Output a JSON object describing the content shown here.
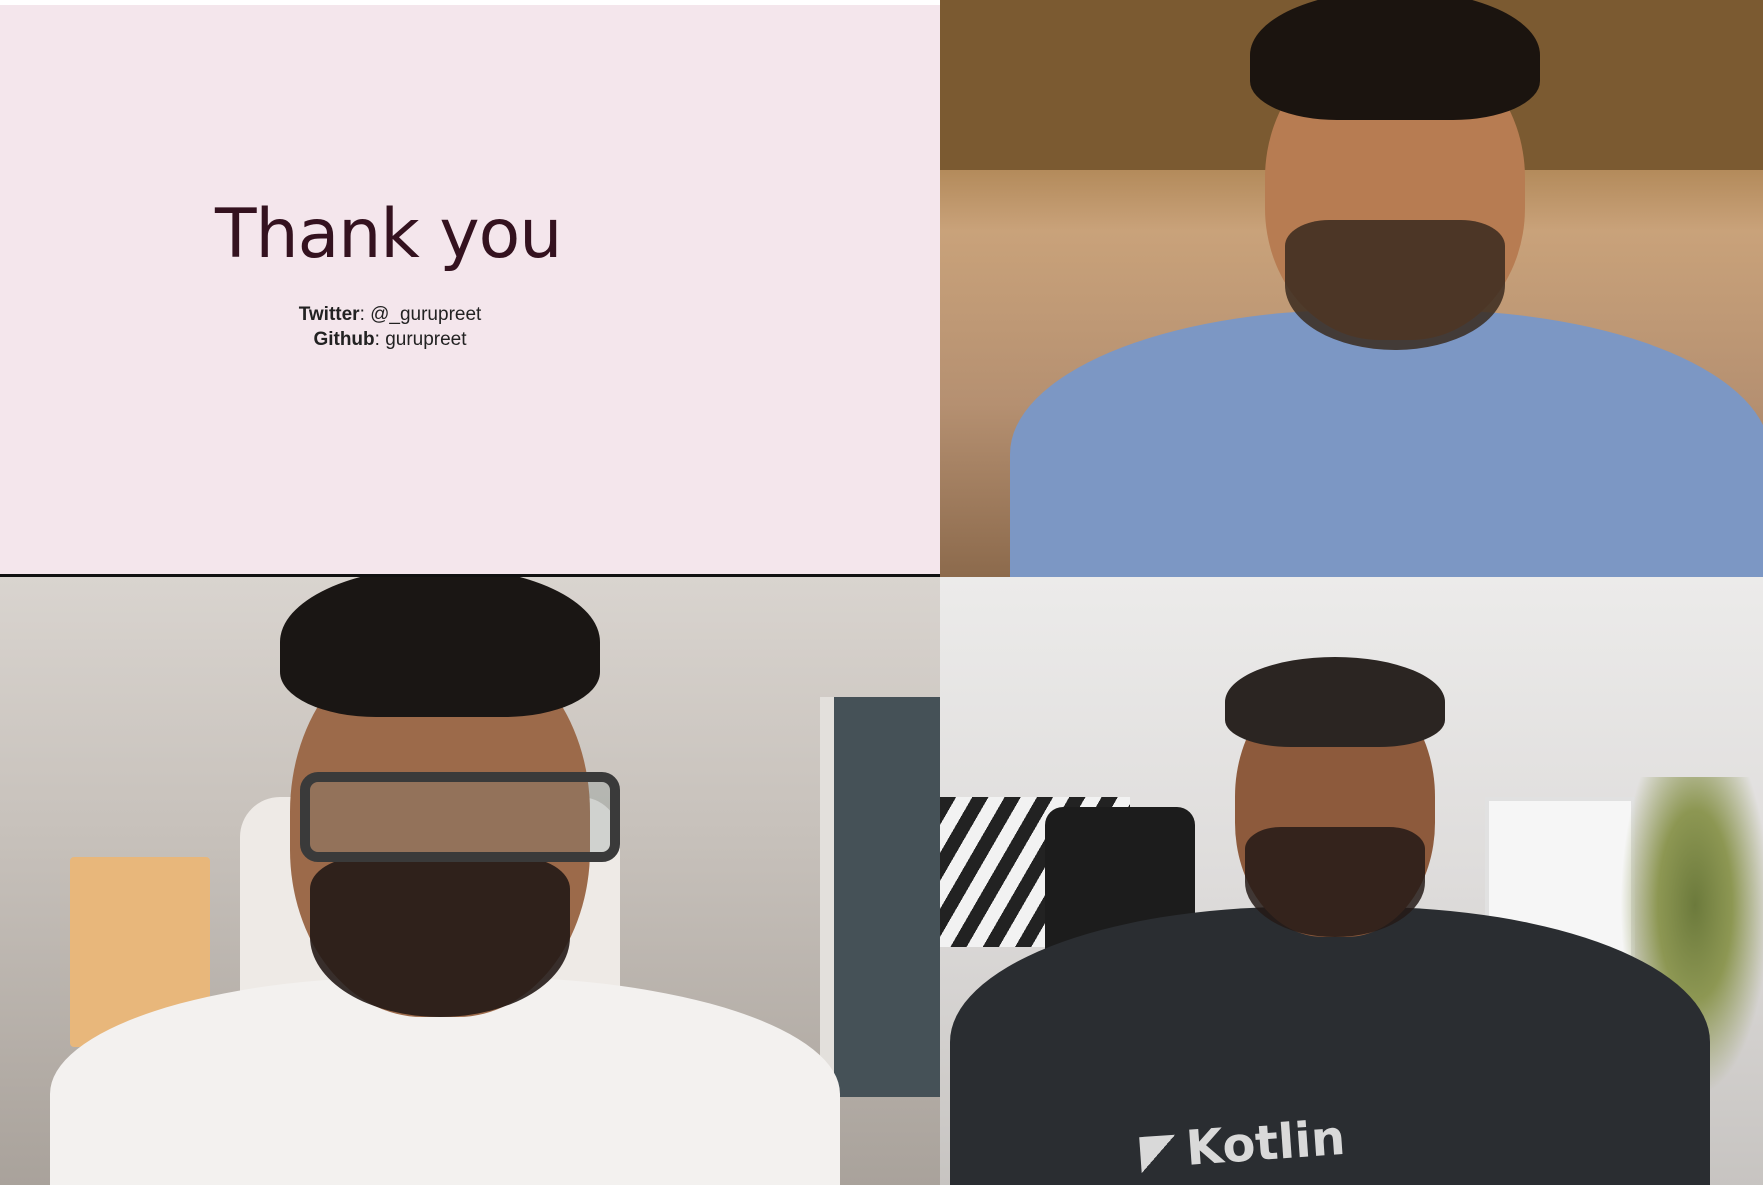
{
  "slide": {
    "title": "Thank you",
    "twitter_label": "Twitter",
    "twitter_value": ": @_gurupreet",
    "github_label": "Github",
    "github_value": ": gurupreet"
  },
  "participants": [
    {
      "shirt_text": ""
    },
    {
      "shirt_text": ""
    },
    {
      "shirt_text": "Kotlin"
    }
  ],
  "colors": {
    "slide_background": "#f4e6ec",
    "slide_title": "#34121f"
  }
}
